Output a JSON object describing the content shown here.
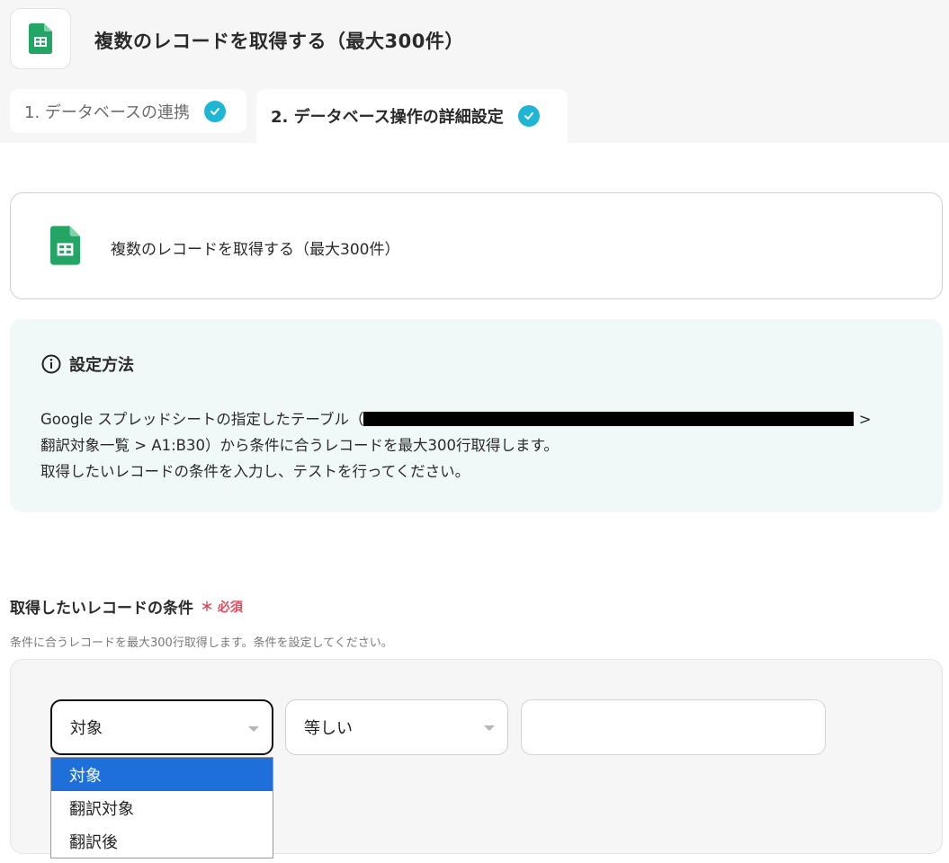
{
  "header": {
    "title": "複数のレコードを取得する（最大300件）"
  },
  "tabs": [
    {
      "label": "1. データベースの連携",
      "completed": true
    },
    {
      "label": "2. データベース操作の詳細設定",
      "completed": true,
      "active": true
    }
  ],
  "action_card": {
    "title": "複数のレコードを取得する（最大300件）",
    "icon": "google-sheets-icon"
  },
  "info": {
    "heading": "設定方法",
    "line1_prefix": "Google スプレッドシートの指定したテーブル（",
    "line1_suffix": " >",
    "line2": "翻訳対象一覧 > A1:B30）から条件に合うレコードを最大300行取得します。",
    "line3": "取得したいレコードの条件を入力し、テストを行ってください。"
  },
  "conditions": {
    "label": "取得したいレコードの条件",
    "required_label": "＊ 必須",
    "hint": "条件に合うレコードを最大300行取得します。条件を設定してください。",
    "target_value": "対象",
    "operator_value": "等しい",
    "input_value": "",
    "dropdown_options": [
      "対象",
      "翻訳対象",
      "翻訳後"
    ],
    "selected_option": "対象"
  },
  "colors": {
    "accent_check": "#1fb6d6",
    "required": "#e24a5c",
    "sheets_green": "#23a566",
    "dropdown_selected": "#1e6fd9",
    "info_bg": "#f1f8f8"
  }
}
